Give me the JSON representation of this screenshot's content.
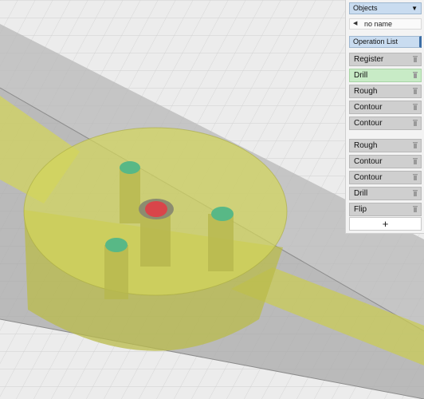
{
  "objects_panel": {
    "title": "Objects",
    "object_name": "no name"
  },
  "operations_panel": {
    "title": "Operation List",
    "operations": [
      {
        "label": "Register",
        "active": false
      },
      {
        "label": "Drill",
        "active": true
      },
      {
        "label": "Rough",
        "active": false
      },
      {
        "label": "Contour",
        "active": false
      },
      {
        "label": "Contour",
        "active": false
      },
      {
        "label": "Rough",
        "active": false
      },
      {
        "label": "Contour",
        "active": false
      },
      {
        "label": "Contour",
        "active": false
      },
      {
        "label": "Drill",
        "active": false
      },
      {
        "label": "Flip",
        "active": false
      }
    ],
    "add_label": "+"
  },
  "icons": [
    "chevron-down-icon",
    "collapse-triangle-icon",
    "trash-icon",
    "plus-icon"
  ],
  "colors": {
    "model": "#d2d45a",
    "drill_point": "#58b886",
    "selected_drill": "#d9454a",
    "active_op": "#c8ebc6",
    "header": "#c9dcf0"
  }
}
